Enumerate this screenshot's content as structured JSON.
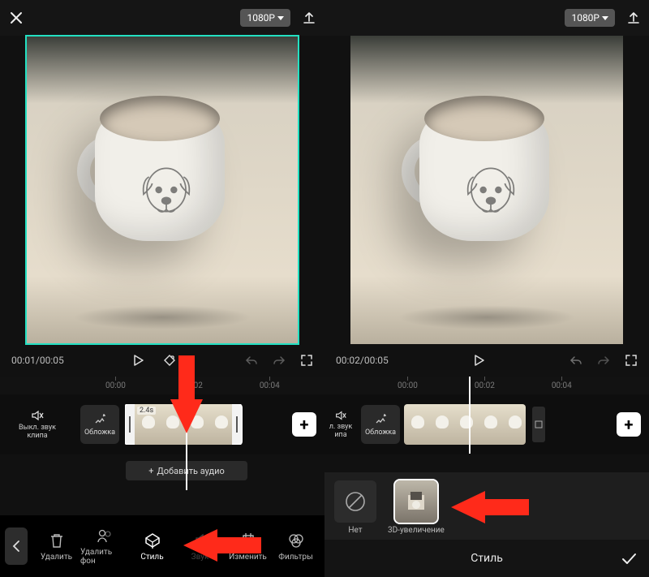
{
  "left": {
    "resolution": "1080P",
    "time": "00:01/00:05",
    "ruler": [
      "00:00",
      "00:02",
      "00:04"
    ],
    "muteLabel": "Выкл. звук клипа",
    "coverLabel": "Обложка",
    "clipDuration": "2.4s",
    "addAudioLabel": "Добавить аудио",
    "tools": [
      {
        "label": "Удалить"
      },
      {
        "label": "Удалить фон"
      },
      {
        "label": "Стиль"
      },
      {
        "label": "Звук"
      },
      {
        "label": "Изменить"
      },
      {
        "label": "Фильтры"
      }
    ]
  },
  "right": {
    "resolution": "1080P",
    "time": "00:02/00:05",
    "ruler": [
      "00:00",
      "00:02",
      "00:04"
    ],
    "muteLabel": "л. звук ипа",
    "coverLabel": "Обложка",
    "options": {
      "none": "Нет",
      "zoom3d": "3D-увеличение"
    },
    "panelTitle": "Стиль"
  }
}
